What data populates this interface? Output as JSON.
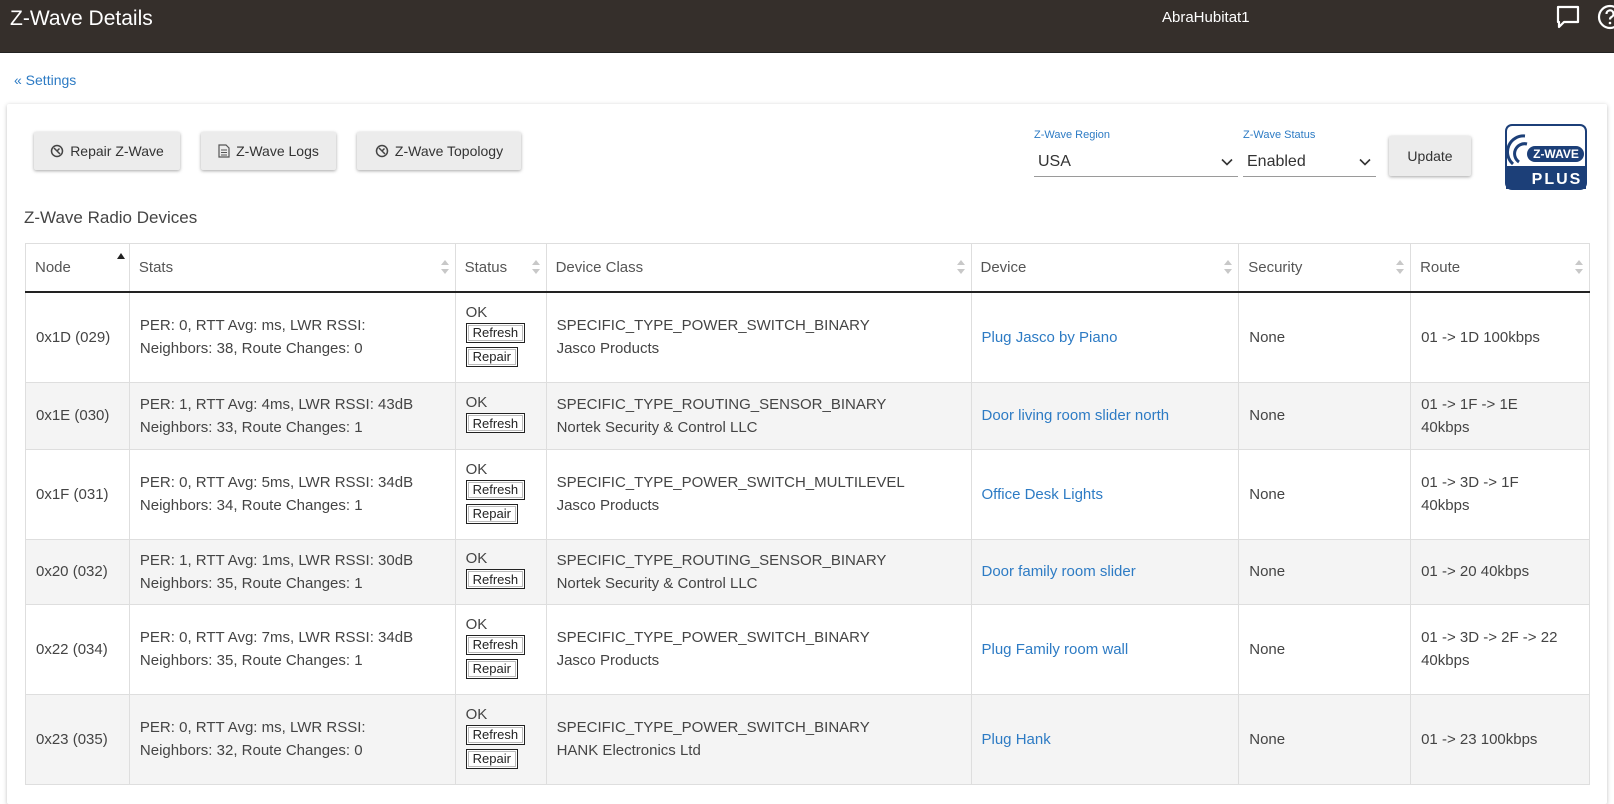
{
  "header": {
    "title": "Z-Wave Details",
    "hub_name": "AbraHubitat1",
    "icons": [
      "chat-icon",
      "help-icon"
    ]
  },
  "breadcrumb": {
    "settings_link": "« Settings"
  },
  "toolbar": {
    "repair_label": "Repair Z-Wave",
    "logs_label": "Z-Wave Logs",
    "topology_label": "Z-Wave Topology",
    "region_label": "Z-Wave Region",
    "region_value": "USA",
    "status_label": "Z-Wave Status",
    "status_value": "Enabled",
    "update_label": "Update"
  },
  "logo": {
    "text_top": "Z-WAVE",
    "text_bottom": "PLUS"
  },
  "section_title": "Z-Wave Radio Devices",
  "table": {
    "columns": [
      "Node",
      "Stats",
      "Status",
      "Device Class",
      "Device",
      "Security",
      "Route"
    ],
    "sorted_column": "Node",
    "rows": [
      {
        "node": "0x1D (029)",
        "stats1": "PER: 0, RTT Avg: ms, LWR RSSI:",
        "stats2": "Neighbors: 38, Route Changes: 0",
        "status": "OK",
        "buttons": [
          "Refresh",
          "Repair"
        ],
        "class1": "SPECIFIC_TYPE_POWER_SWITCH_BINARY",
        "class2": "Jasco Products",
        "device": "Plug Jasco by Piano",
        "security": "None",
        "route1": "01 -> 1D 100kbps",
        "route2": ""
      },
      {
        "node": "0x1E (030)",
        "stats1": "PER: 1, RTT Avg: 4ms, LWR RSSI: 43dB",
        "stats2": "Neighbors: 33, Route Changes: 1",
        "status": "OK",
        "buttons": [
          "Refresh"
        ],
        "class1": "SPECIFIC_TYPE_ROUTING_SENSOR_BINARY",
        "class2": "Nortek Security & Control LLC",
        "device": "Door living room slider north",
        "security": "None",
        "route1": "01 -> 1F -> 1E",
        "route2": "40kbps"
      },
      {
        "node": "0x1F (031)",
        "stats1": "PER: 0, RTT Avg: 5ms, LWR RSSI: 34dB",
        "stats2": "Neighbors: 34, Route Changes: 1",
        "status": "OK",
        "buttons": [
          "Refresh",
          "Repair"
        ],
        "class1": "SPECIFIC_TYPE_POWER_SWITCH_MULTILEVEL",
        "class2": "Jasco Products",
        "device": "Office Desk Lights",
        "security": "None",
        "route1": "01 -> 3D -> 1F",
        "route2": "40kbps"
      },
      {
        "node": "0x20 (032)",
        "stats1": "PER: 1, RTT Avg: 1ms, LWR RSSI: 30dB",
        "stats2": "Neighbors: 35, Route Changes: 1",
        "status": "OK",
        "buttons": [
          "Refresh"
        ],
        "class1": "SPECIFIC_TYPE_ROUTING_SENSOR_BINARY",
        "class2": "Nortek Security & Control LLC",
        "device": "Door family room slider",
        "security": "None",
        "route1": "01 -> 20 40kbps",
        "route2": ""
      },
      {
        "node": "0x22 (034)",
        "stats1": "PER: 0, RTT Avg: 7ms, LWR RSSI: 34dB",
        "stats2": "Neighbors: 35, Route Changes: 1",
        "status": "OK",
        "buttons": [
          "Refresh",
          "Repair"
        ],
        "class1": "SPECIFIC_TYPE_POWER_SWITCH_BINARY",
        "class2": "Jasco Products",
        "device": "Plug Family room wall",
        "security": "None",
        "route1": "01 -> 3D -> 2F -> 22",
        "route2": "40kbps"
      },
      {
        "node": "0x23 (035)",
        "stats1": "PER: 0, RTT Avg: ms, LWR RSSI:",
        "stats2": "Neighbors: 32, Route Changes: 0",
        "status": "OK",
        "buttons": [
          "Refresh",
          "Repair"
        ],
        "class1": "SPECIFIC_TYPE_POWER_SWITCH_BINARY",
        "class2": "HANK Electronics Ltd",
        "device": "Plug Hank",
        "security": "None",
        "route1": "01 -> 23 100kbps",
        "route2": ""
      }
    ]
  },
  "colors": {
    "topbar": "#352f2b",
    "link": "#2d7bc4",
    "logo_blue": "#1c3f78"
  }
}
